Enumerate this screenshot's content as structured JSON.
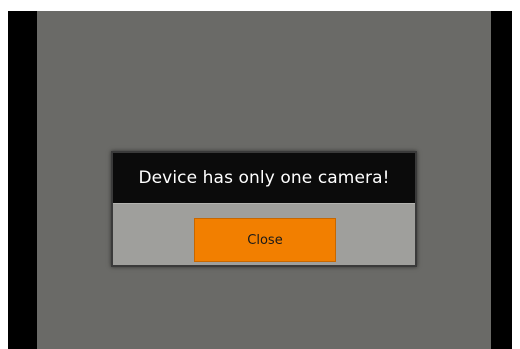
{
  "dialog": {
    "title": "Device has only one camera!",
    "close_label": "Close"
  },
  "colors": {
    "frame": "#000000",
    "screen": "#6a6a67",
    "dialog_header": "#0b0b0b",
    "dialog_body": "#9f9f9c",
    "accent_button": "#f27f00"
  }
}
